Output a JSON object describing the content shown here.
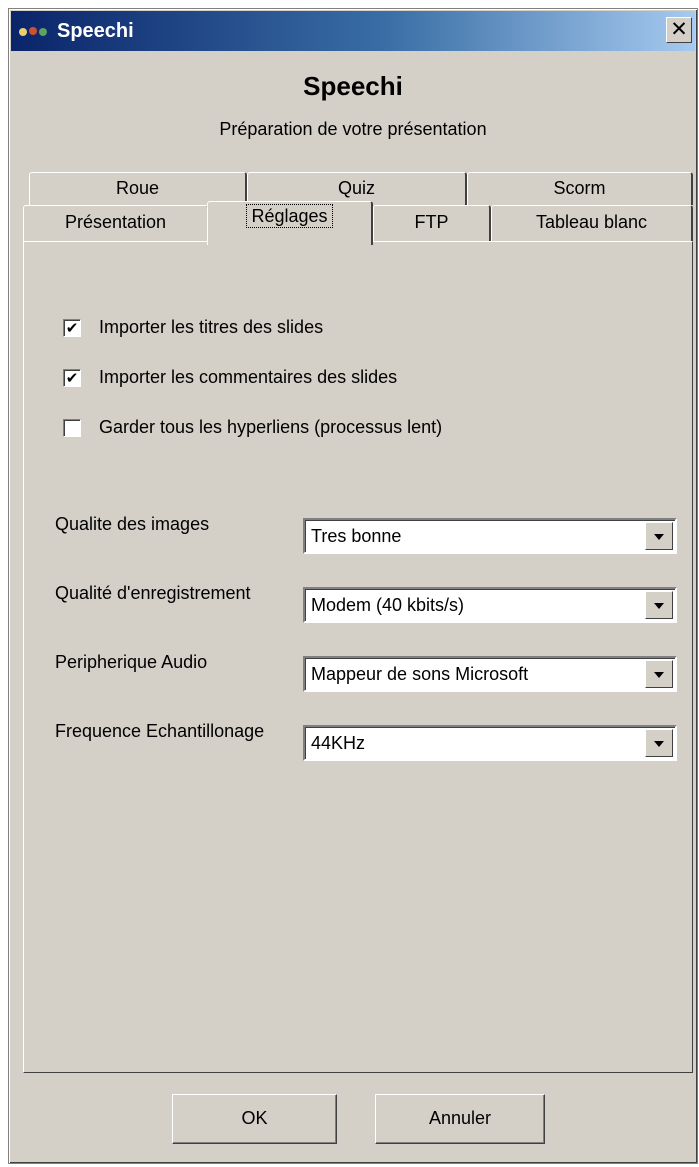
{
  "window": {
    "title": "Speechi",
    "close_glyph": "✕",
    "heading": "Speechi",
    "subheading": "Préparation de votre présentation"
  },
  "tabs": {
    "row1": [
      "Roue",
      "Quiz",
      "Scorm"
    ],
    "row2": [
      "Présentation",
      "Réglages",
      "FTP",
      "Tableau blanc"
    ],
    "active": "Réglages"
  },
  "options": [
    {
      "label": "Importer les titres des slides",
      "checked": true
    },
    {
      "label": "Importer les commentaires des slides",
      "checked": true
    },
    {
      "label": "Garder tous les hyperliens (processus lent)",
      "checked": false
    }
  ],
  "fields": [
    {
      "label": "Qualite des images",
      "value": "Tres bonne"
    },
    {
      "label": "Qualité d'enregistrement",
      "value": "Modem (40 kbits/s)"
    },
    {
      "label": "Peripherique Audio",
      "value": "Mappeur de sons Microsoft"
    },
    {
      "label": "Frequence Echantillonage",
      "value": "44KHz"
    }
  ],
  "buttons": {
    "ok": "OK",
    "cancel": "Annuler"
  },
  "check_glyph": "✔",
  "icons": {
    "app": "speechi-app-icon",
    "close": "close-icon",
    "dropdown": "dropdown-arrow-icon"
  },
  "colors": {
    "face": "#d4d0c8",
    "title_start": "#0a246a",
    "title_end": "#a6caf0"
  }
}
